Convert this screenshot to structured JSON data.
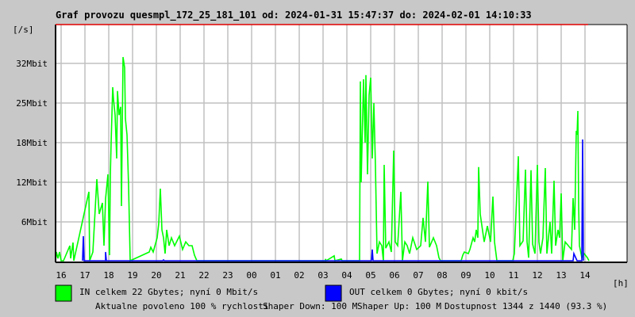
{
  "chart_data": {
    "type": "line",
    "title": "Graf provozu quesmpl_172_25_181_101 od: 2024-01-31 15:47:37 do: 2024-02-01 14:10:33",
    "ylabel": "[/s]",
    "xlabel": "[h]",
    "x_unit": "minutes since 16:00",
    "y_unit": "Mbit/s",
    "ylim": [
      0,
      37.5
    ],
    "xlim": [
      -14,
      1326
    ],
    "grid": true,
    "y_ticks": [
      {
        "value": 6.25,
        "label": "6Mbit"
      },
      {
        "value": 12.5,
        "label": "12Mbit"
      },
      {
        "value": 18.75,
        "label": "18Mbit"
      },
      {
        "value": 25,
        "label": "25Mbit"
      },
      {
        "value": 31.25,
        "label": "32Mbit"
      }
    ],
    "x_ticks": [
      "16",
      "17",
      "18",
      "19",
      "20",
      "21",
      "22",
      "23",
      "00",
      "01",
      "02",
      "03",
      "04",
      "05",
      "06",
      "07",
      "08",
      "09",
      "10",
      "11",
      "12",
      "13",
      "14"
    ],
    "series": [
      {
        "name": "IN",
        "color": "#00ff00",
        "points": [
          [
            -14,
            0
          ],
          [
            -12,
            1.5
          ],
          [
            -8,
            0.5
          ],
          [
            -4,
            1.5
          ],
          [
            0,
            0
          ],
          [
            6,
            0
          ],
          [
            22,
            2.5
          ],
          [
            24,
            0.5
          ],
          [
            30,
            3
          ],
          [
            32,
            0
          ],
          [
            70,
            11
          ],
          [
            72,
            0
          ],
          [
            80,
            1.5
          ],
          [
            90,
            13
          ],
          [
            96,
            7.5
          ],
          [
            104,
            9.25
          ],
          [
            108,
            2.5
          ],
          [
            112,
            9.9
          ],
          [
            118,
            13.75
          ],
          [
            122,
            1
          ],
          [
            124,
            13.6
          ],
          [
            126,
            18.75
          ],
          [
            130,
            27.5
          ],
          [
            132,
            25.6
          ],
          [
            136,
            23.1
          ],
          [
            140,
            16.25
          ],
          [
            142,
            26.9
          ],
          [
            146,
            23.1
          ],
          [
            150,
            24.4
          ],
          [
            152,
            8.75
          ],
          [
            156,
            32.25
          ],
          [
            160,
            30.6
          ],
          [
            162,
            22.5
          ],
          [
            166,
            20
          ],
          [
            170,
            11.9
          ],
          [
            174,
            0
          ],
          [
            222,
            1.5
          ],
          [
            226,
            2.25
          ],
          [
            232,
            1.5
          ],
          [
            242,
            3.75
          ],
          [
            246,
            6
          ],
          [
            250,
            11.5
          ],
          [
            254,
            5
          ],
          [
            258,
            3.75
          ],
          [
            262,
            1.25
          ],
          [
            266,
            5
          ],
          [
            272,
            2.5
          ],
          [
            278,
            3.75
          ],
          [
            286,
            2.5
          ],
          [
            298,
            4
          ],
          [
            306,
            1.9
          ],
          [
            314,
            3.1
          ],
          [
            322,
            2.5
          ],
          [
            330,
            2.5
          ],
          [
            336,
            1
          ],
          [
            342,
            0
          ],
          [
            666,
            0
          ],
          [
            666,
            0.4
          ],
          [
            668,
            0
          ],
          [
            688,
            0.9
          ],
          [
            690,
            0
          ],
          [
            706,
            0.4
          ],
          [
            708,
            0
          ],
          [
            752,
            0
          ],
          [
            754,
            28.4
          ],
          [
            756,
            12.5
          ],
          [
            762,
            28.75
          ],
          [
            766,
            18.75
          ],
          [
            768,
            29.4
          ],
          [
            772,
            13.75
          ],
          [
            776,
            26.25
          ],
          [
            780,
            29
          ],
          [
            784,
            16.25
          ],
          [
            788,
            25
          ],
          [
            792,
            15
          ],
          [
            796,
            1.25
          ],
          [
            802,
            3.1
          ],
          [
            808,
            2.5
          ],
          [
            812,
            0
          ],
          [
            814,
            15.25
          ],
          [
            818,
            2.1
          ],
          [
            826,
            3.1
          ],
          [
            832,
            1.5
          ],
          [
            838,
            17.5
          ],
          [
            842,
            3.1
          ],
          [
            848,
            2.5
          ],
          [
            856,
            11
          ],
          [
            860,
            0
          ],
          [
            866,
            3.1
          ],
          [
            872,
            2.5
          ],
          [
            878,
            1.25
          ],
          [
            886,
            3.75
          ],
          [
            896,
            1.9
          ],
          [
            906,
            2.5
          ],
          [
            912,
            6.9
          ],
          [
            918,
            3.1
          ],
          [
            924,
            12.6
          ],
          [
            928,
            2.25
          ],
          [
            938,
            3.75
          ],
          [
            946,
            2.5
          ],
          [
            952,
            0.6
          ],
          [
            956,
            0
          ],
          [
            1008,
            0
          ],
          [
            1012,
            1
          ],
          [
            1016,
            1.5
          ],
          [
            1026,
            1.25
          ],
          [
            1030,
            1.9
          ],
          [
            1038,
            3.75
          ],
          [
            1042,
            3.1
          ],
          [
            1046,
            5
          ],
          [
            1050,
            3.75
          ],
          [
            1052,
            14.9
          ],
          [
            1056,
            7.5
          ],
          [
            1066,
            3.1
          ],
          [
            1074,
            5.6
          ],
          [
            1082,
            3.1
          ],
          [
            1088,
            10.25
          ],
          [
            1092,
            3.1
          ],
          [
            1098,
            0
          ],
          [
            1138,
            0
          ],
          [
            1142,
            1.25
          ],
          [
            1152,
            16.6
          ],
          [
            1156,
            2.5
          ],
          [
            1164,
            3.25
          ],
          [
            1170,
            14.5
          ],
          [
            1174,
            3.1
          ],
          [
            1178,
            0.6
          ],
          [
            1184,
            14.4
          ],
          [
            1188,
            2.75
          ],
          [
            1194,
            1.25
          ],
          [
            1200,
            15.25
          ],
          [
            1204,
            3.1
          ],
          [
            1208,
            1.25
          ],
          [
            1214,
            3.75
          ],
          [
            1220,
            14.75
          ],
          [
            1224,
            1.25
          ],
          [
            1232,
            6.25
          ],
          [
            1236,
            1.25
          ],
          [
            1242,
            12.75
          ],
          [
            1246,
            2.5
          ],
          [
            1252,
            5
          ],
          [
            1256,
            3.75
          ],
          [
            1260,
            10.75
          ],
          [
            1264,
            0
          ],
          [
            1270,
            3.1
          ],
          [
            1278,
            2.5
          ],
          [
            1286,
            1.9
          ],
          [
            1290,
            10
          ],
          [
            1294,
            5
          ],
          [
            1298,
            20.6
          ],
          [
            1300,
            20
          ],
          [
            1302,
            23.75
          ],
          [
            1304,
            8.75
          ],
          [
            1306,
            2.5
          ],
          [
            1312,
            0.6
          ],
          [
            1318,
            1.25
          ],
          [
            1326,
            0.6
          ],
          [
            1330,
            0
          ]
        ]
      },
      {
        "name": "OUT",
        "color": "#0000ff",
        "points": [
          [
            54,
            0
          ],
          [
            56,
            4
          ],
          [
            58,
            0
          ],
          [
            112,
            0
          ],
          [
            112,
            1.5
          ],
          [
            114,
            0
          ],
          [
            256,
            0
          ],
          [
            258,
            0.25
          ],
          [
            260,
            0
          ],
          [
            782,
            0
          ],
          [
            784,
            1.9
          ],
          [
            786,
            0
          ],
          [
            1290,
            0
          ],
          [
            1292,
            1.25
          ],
          [
            1300,
            0
          ],
          [
            1312,
            0
          ],
          [
            1314,
            19.25
          ],
          [
            1316,
            0
          ]
        ]
      }
    ]
  },
  "legend": {
    "in_text": "IN celkem 22 Gbytes; nyní 0 Mbit/s",
    "out_text": "OUT celkem 0 Gbytes; nyní 0 kbit/s",
    "in_color": "#00ff00",
    "out_color": "#0000ff"
  },
  "status": {
    "allowed": "Aktualne povoleno 100 % rychlosti",
    "shaper_down": "Shaper Down: 100 M",
    "shaper_up": "Shaper Up: 100 M",
    "availability": "Dostupnost 1344 z 1440 (93.3 %)",
    "allowed_color": "#ff0000",
    "shaper_up_color": "#990099"
  }
}
